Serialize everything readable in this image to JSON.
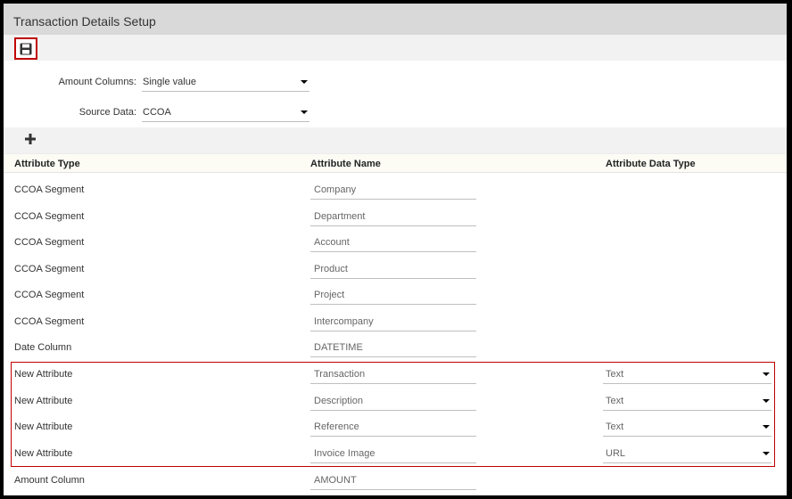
{
  "page": {
    "title": "Transaction Details Setup"
  },
  "form": {
    "amount_columns": {
      "label": "Amount Columns:",
      "value": "Single value"
    },
    "source_data": {
      "label": "Source Data:",
      "value": "CCOA"
    }
  },
  "table": {
    "headers": {
      "type": "Attribute Type",
      "name": "Attribute Name",
      "data_type": "Attribute Data Type"
    },
    "rows": [
      {
        "type": "CCOA Segment",
        "name": "Company"
      },
      {
        "type": "CCOA Segment",
        "name": "Department"
      },
      {
        "type": "CCOA Segment",
        "name": "Account"
      },
      {
        "type": "CCOA Segment",
        "name": "Product"
      },
      {
        "type": "CCOA Segment",
        "name": "Project"
      },
      {
        "type": "CCOA Segment",
        "name": "Intercompany"
      },
      {
        "type": "Date Column",
        "name": "DATETIME"
      },
      {
        "type": "New Attribute",
        "name": "Transaction",
        "data_type": "Text"
      },
      {
        "type": "New Attribute",
        "name": "Description",
        "data_type": "Text"
      },
      {
        "type": "New Attribute",
        "name": "Reference",
        "data_type": "Text"
      },
      {
        "type": "New Attribute",
        "name": "Invoice Image",
        "data_type": "URL"
      },
      {
        "type": "Amount Column",
        "name": "AMOUNT"
      }
    ]
  },
  "icons": {
    "save": "save-icon",
    "add": "plus-icon",
    "dropdown": "caret-down-icon"
  },
  "colors": {
    "highlight": "#c00000",
    "title_bar": "#d9d9d9",
    "toolbar": "#f2f2f2"
  }
}
